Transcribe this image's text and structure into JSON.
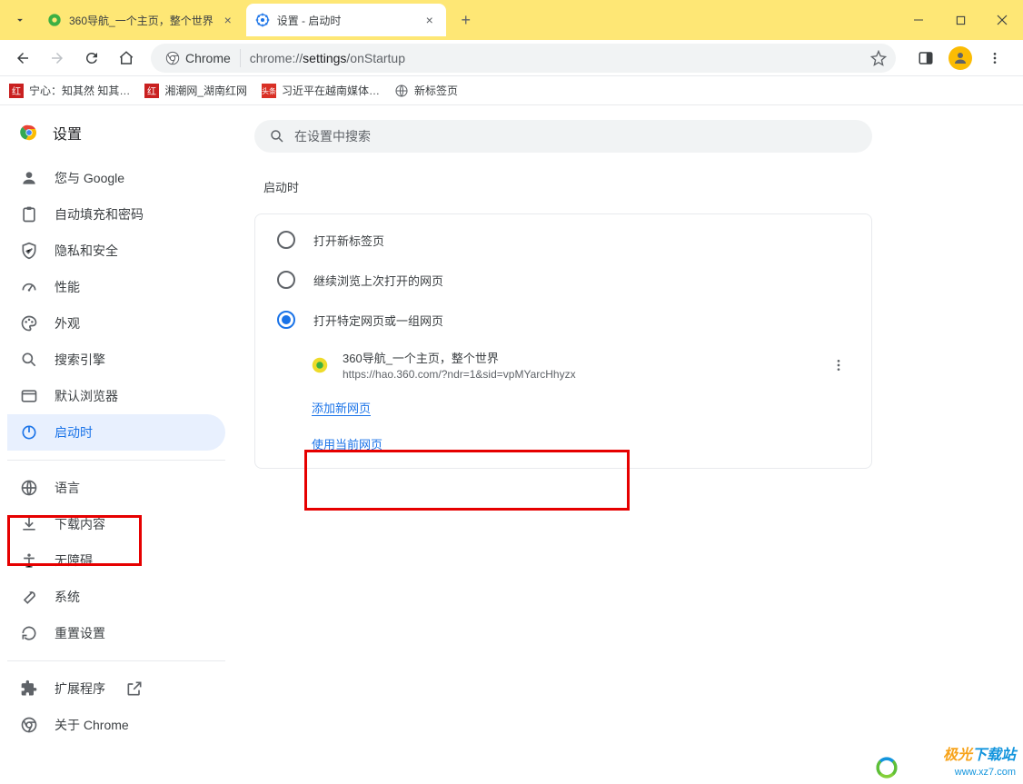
{
  "tabs": [
    {
      "title": "360导航_一个主页，整个世界"
    },
    {
      "title": "设置 - 启动时"
    }
  ],
  "url": {
    "chip": "Chrome",
    "path_prefix": "chrome://",
    "path_mid": "settings",
    "path_suffix": "/onStartup"
  },
  "bookmarks": [
    {
      "label": "宁心：知其然 知其…"
    },
    {
      "label": "湘潮网_湖南红网"
    },
    {
      "label": "习近平在越南媒体…"
    },
    {
      "label": "新标签页"
    }
  ],
  "sidebar": {
    "title": "设置",
    "items": [
      {
        "label": "您与 Google"
      },
      {
        "label": "自动填充和密码"
      },
      {
        "label": "隐私和安全"
      },
      {
        "label": "性能"
      },
      {
        "label": "外观"
      },
      {
        "label": "搜索引擎"
      },
      {
        "label": "默认浏览器"
      },
      {
        "label": "启动时"
      },
      {
        "label": "语言"
      },
      {
        "label": "下载内容"
      },
      {
        "label": "无障碍"
      },
      {
        "label": "系统"
      },
      {
        "label": "重置设置"
      },
      {
        "label": "扩展程序"
      },
      {
        "label": "关于 Chrome"
      }
    ]
  },
  "search_placeholder": "在设置中搜索",
  "section_title": "启动时",
  "radios": [
    {
      "label": "打开新标签页"
    },
    {
      "label": "继续浏览上次打开的网页"
    },
    {
      "label": "打开特定网页或一组网页"
    }
  ],
  "startup_page": {
    "title": "360导航_一个主页，整个世界",
    "url": "https://hao.360.com/?ndr=1&sid=vpMYarcHhyzx"
  },
  "links": {
    "add": "添加新网页",
    "use_current": "使用当前网页"
  },
  "watermark": {
    "brand_a": "极光",
    "brand_b": "下载站",
    "url": "www.xz7.com"
  }
}
